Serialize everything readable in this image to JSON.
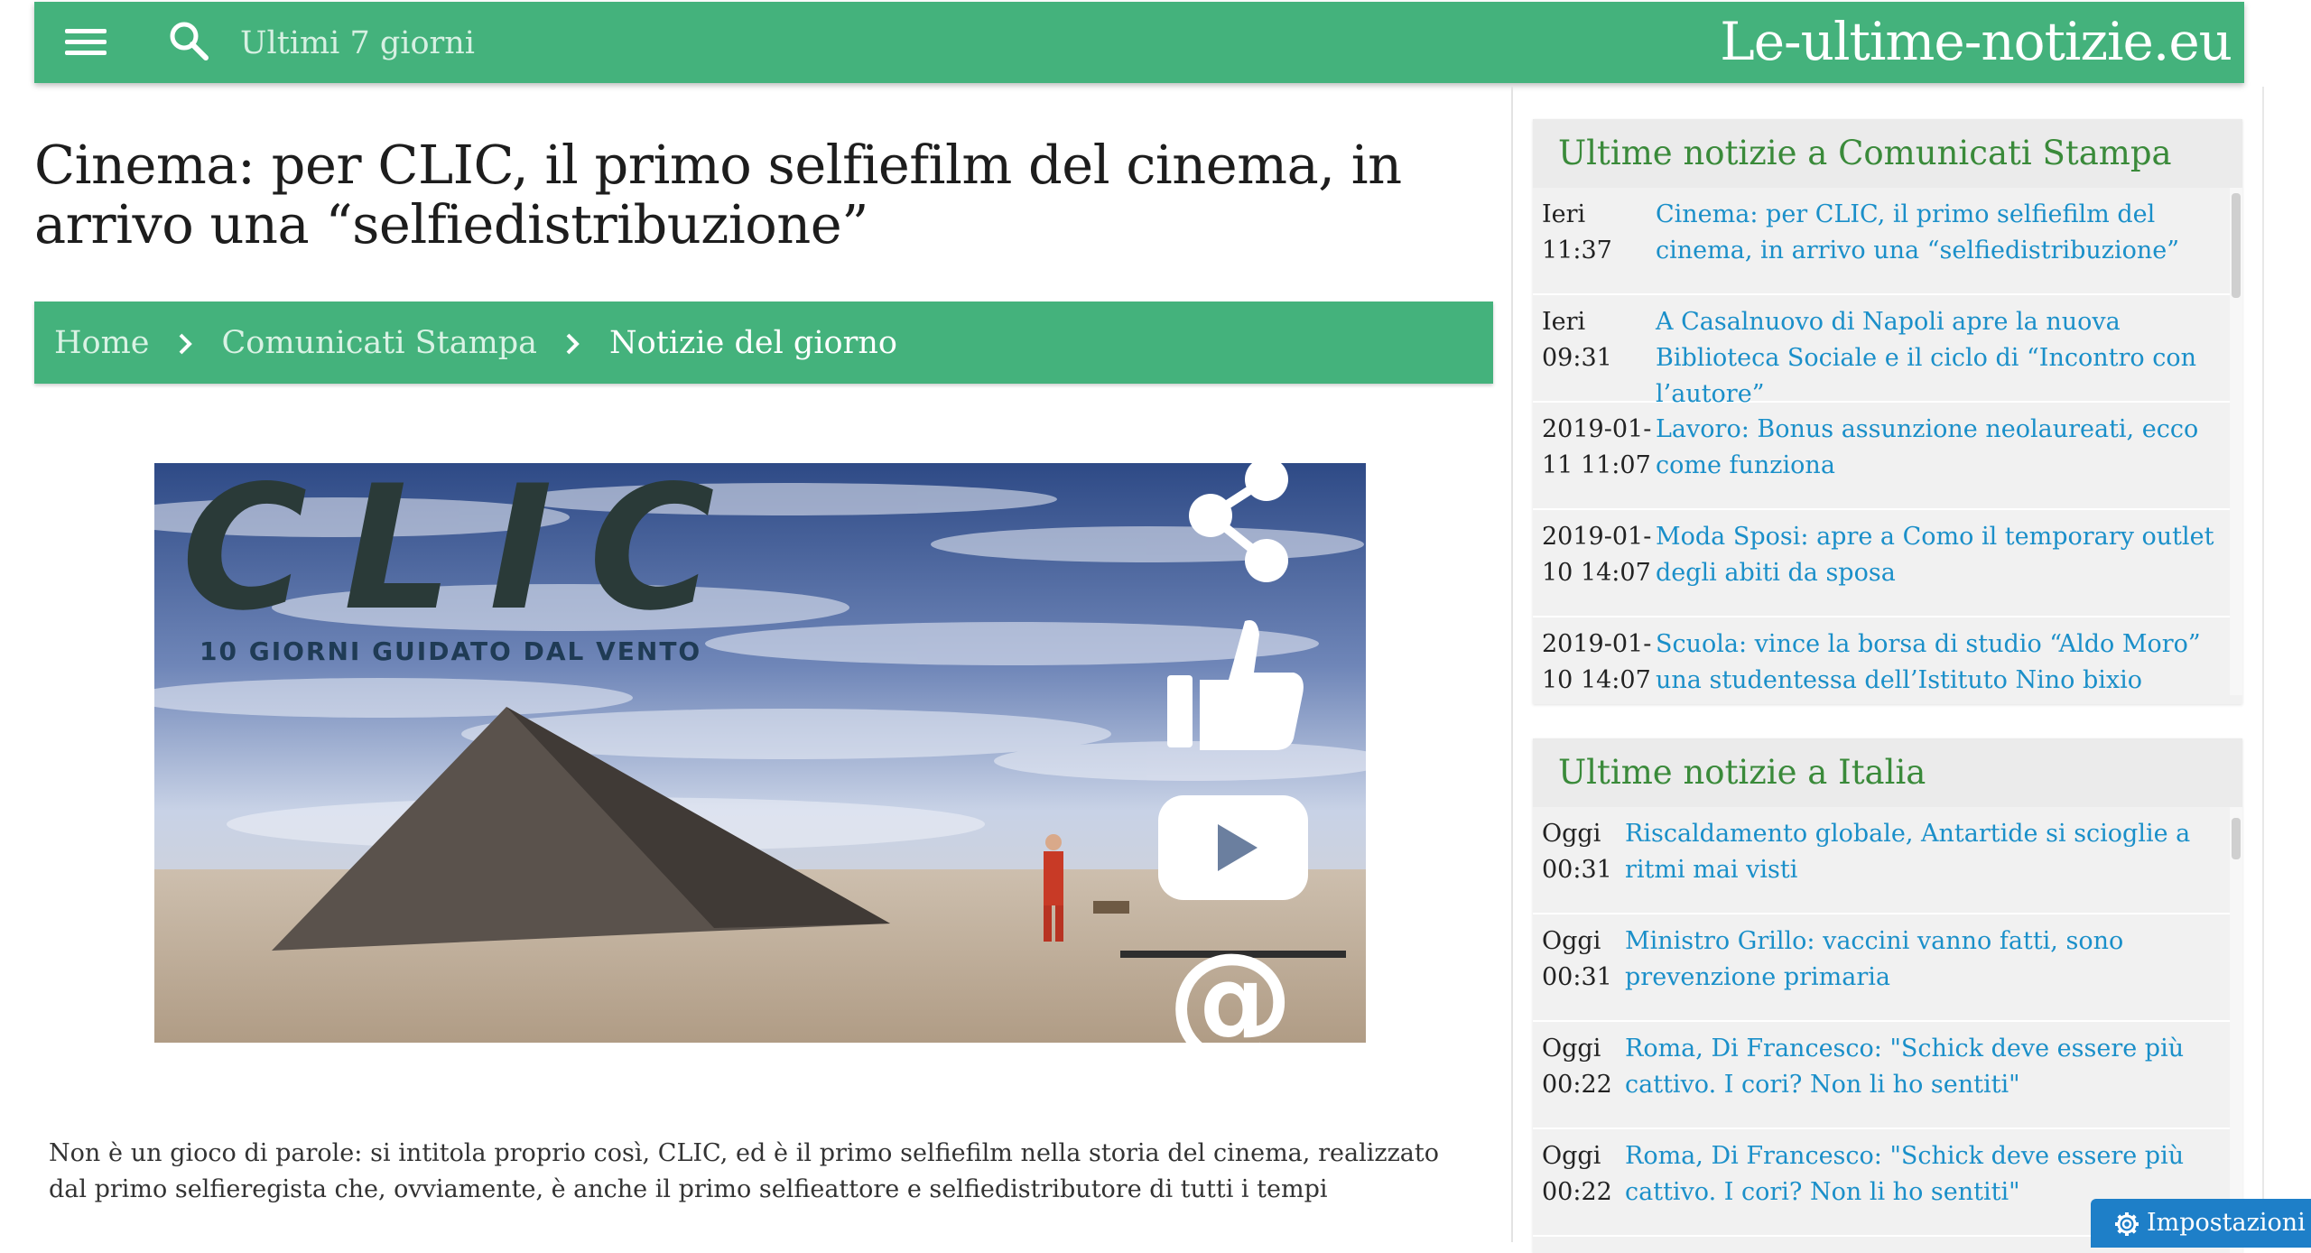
{
  "header": {
    "search_placeholder": "Ultimi 7 giorni",
    "site_title": "Le-ultime-notizie.eu"
  },
  "article": {
    "title": "Cinema: per CLIC, il primo selfiefilm del cinema, in arrivo una “selfiedistribuzione”",
    "breadcrumb": [
      "Home",
      "Comunicati Stampa",
      "Notizie del giorno"
    ],
    "image": {
      "logo_text": "CLIC",
      "tagline": "10 GIORNI GUIDATO DAL VENTO"
    },
    "body": "Non è un gioco di parole: si intitola proprio così, CLIC, ed è il primo selfiefilm nella storia del cinema, realizzato dal primo selfieregista che, ovviamente, è anche il primo selfieattore e selfiedistributore di tutti i tempi"
  },
  "sidebar": {
    "widget1": {
      "title": "Ultime notizie a Comunicati Stampa",
      "items": [
        {
          "time1": "Ieri",
          "time2": "11:37",
          "text": "Cinema: per CLIC, il primo selfiefilm del cinema, in arrivo una “selfiedistribuzione”"
        },
        {
          "time1": "Ieri",
          "time2": "09:31",
          "text": "A Casalnuovo di Napoli apre la nuova Biblioteca Sociale e il ciclo di “Incontro con l’autore”"
        },
        {
          "time1": "2019-01-",
          "time2": "11 11:07",
          "text": "Lavoro: Bonus assunzione neolaureati, ecco come funziona"
        },
        {
          "time1": "2019-01-",
          "time2": "10 14:07",
          "text": "Moda Sposi: apre a Como il temporary outlet degli abiti da sposa"
        },
        {
          "time1": "2019-01-",
          "time2": "10 14:07",
          "text": "Scuola: vince la borsa di studio “Aldo Moro” una studentessa dell’Istituto Nino bixio"
        }
      ]
    },
    "widget2": {
      "title": "Ultime notizie a Italia",
      "items": [
        {
          "time1": "Oggi",
          "time2": "00:31",
          "text": "Riscaldamento globale, Antartide si scioglie a ritmi mai visti"
        },
        {
          "time1": "Oggi",
          "time2": "00:31",
          "text": "Ministro Grillo: vaccini vanno fatti, sono prevenzione primaria"
        },
        {
          "time1": "Oggi",
          "time2": "00:22",
          "text": "Roma, Di Francesco: \"Schick deve essere più cattivo. I cori? Non li ho sentiti\""
        },
        {
          "time1": "Oggi",
          "time2": "00:22",
          "text": "Roma, Di Francesco: \"Schick deve essere più cattivo. I cori? Non li ho sentiti\""
        }
      ]
    }
  },
  "settings_button": "Impostazioni s",
  "colors": {
    "brand_green": "#44b27c",
    "link_blue": "#1a8fc9",
    "widget_title_green": "#3a8a3a",
    "settings_blue": "#1e7fc8"
  }
}
